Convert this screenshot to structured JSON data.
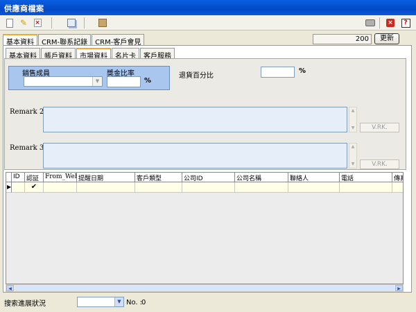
{
  "window": {
    "title": "供應商檔案"
  },
  "toolbar": {
    "new_icon": "new-document-icon",
    "edit_icon": "pencil-icon",
    "delete_icon": "delete-icon",
    "copy_icon": "copy-icon",
    "save_icon": "save-icon",
    "print_icon": "print-icon",
    "close_icon": "close-icon",
    "help_icon": "help-icon",
    "delete_glyph": "×",
    "close_glyph": "×",
    "help_glyph": "?"
  },
  "main_tabs": [
    {
      "label": "基本資料",
      "active": true
    },
    {
      "label": "CRM-聯系記錄",
      "active": false
    },
    {
      "label": "CRM-客戶會見",
      "active": false
    }
  ],
  "record_counter": "200",
  "update_button": "更新",
  "sub_tabs": [
    {
      "label": "基本資料",
      "active": false
    },
    {
      "label": "帳戶資料",
      "active": false
    },
    {
      "label": "市場資料",
      "active": true
    },
    {
      "label": "名片卡",
      "active": false
    },
    {
      "label": "客戶服務",
      "active": false
    }
  ],
  "form": {
    "sales_member_label": "銷售成員",
    "sales_member_value": "",
    "bonus_ratio_label": "獎金比率",
    "bonus_ratio_value": "",
    "percent_symbol": "%",
    "return_pct_label": "退貨百分比",
    "return_pct_value": "",
    "remark2_label": "Remark 2 :",
    "remark2_value": "",
    "remark3_label": "Remark 3 :",
    "remark3_value": "",
    "vrk_button": "V.RK."
  },
  "grid": {
    "columns": [
      "ID",
      "認証",
      "From_Web",
      "提醒日期",
      "客戶類型",
      "公司ID",
      "公司名稱",
      "聯絡人",
      "電話",
      "傳真"
    ],
    "rows": [
      [
        "",
        "✔",
        "",
        "",
        "",
        "",
        "",
        "",
        "",
        ""
      ]
    ],
    "row_indicator": "▶"
  },
  "footer": {
    "search_status_label": "搜索進展狀況",
    "search_status_value": "",
    "count_label": "No. :",
    "count_value": "0"
  },
  "colors": {
    "title_bar": "#0349c8",
    "sales_group_bg": "#a9c6ee",
    "memo_bg": "#e6eefa",
    "grid_row_bg": "#ffffe8"
  }
}
